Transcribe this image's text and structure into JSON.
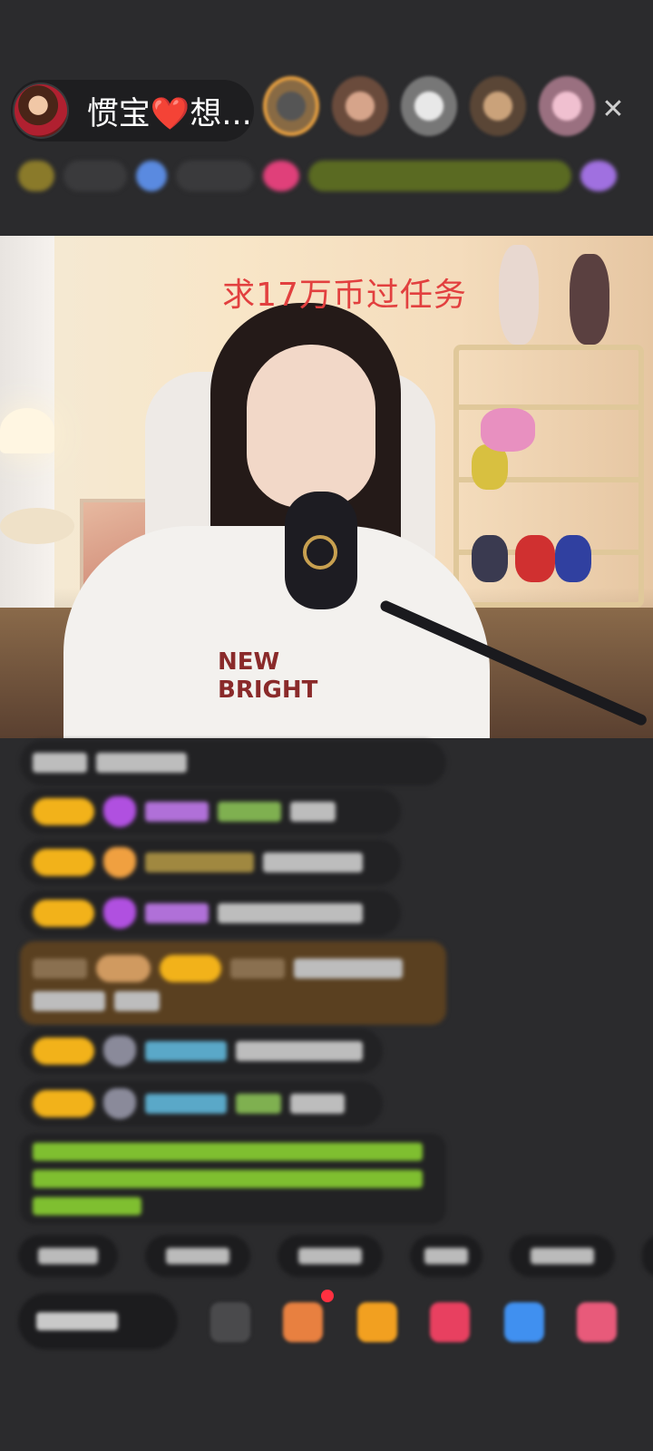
{
  "header": {
    "host_name": "惯宝❤️想...",
    "close_symbol": "✕"
  },
  "viewers": [
    {
      "icon": "viewer-avatar-1"
    },
    {
      "icon": "viewer-avatar-2"
    },
    {
      "icon": "viewer-avatar-3"
    },
    {
      "icon": "viewer-avatar-4"
    },
    {
      "icon": "viewer-avatar-5"
    }
  ],
  "video": {
    "overlay_text": "求17万币过任务",
    "shirt_print": "NEW\nBRIGHT"
  },
  "colors": {
    "background": "#2b2b2d",
    "overlay_text": "#e2403f",
    "level_badge": "#f2b21a",
    "system_message": "#7fbf30"
  }
}
